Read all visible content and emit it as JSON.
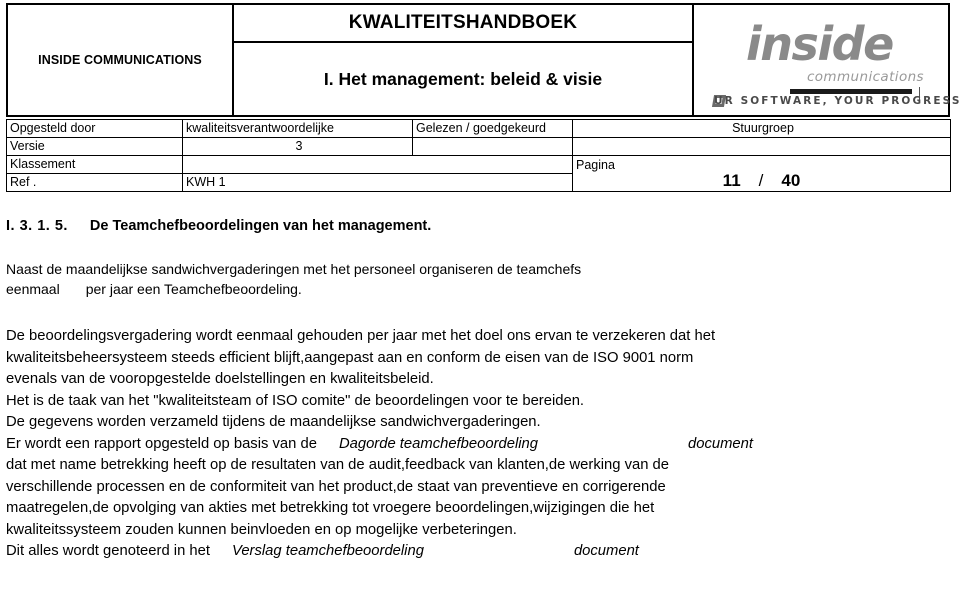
{
  "header": {
    "company_name": "INSIDE COMMUNICATIONS",
    "title_main": "KWALITEITSHANDBOEK",
    "title_sub": "I. Het management: beleid & visie",
    "logo": {
      "wordmark": "inside",
      "sub_wordmark": "communications",
      "tagline": "UR SOFTWARE, YOUR PROGRESS",
      "tagline_full": "OUR SOFTWARE, YOUR PROGRESS"
    }
  },
  "meta_table": {
    "rows": [
      {
        "label": "Opgesteld door",
        "value": "kwaliteitsverantwoordelijke",
        "approval_label": "Gelezen / goedgekeurd",
        "approval_value": "Stuurgroep"
      },
      {
        "label": "Versie",
        "value": "3",
        "approval_label": "",
        "approval_value": ""
      },
      {
        "label": "Klassement",
        "value": "",
        "page_label": "Pagina"
      },
      {
        "label": "Ref .",
        "value": "KWH 1",
        "page_current": "11",
        "page_separator": "/",
        "page_total": "40"
      }
    ]
  },
  "content": {
    "section_number": "I.  3.  1.  5.",
    "section_title": "De Teamchefbeoordelingen van het management.",
    "intro_line_1": "Naast de maandelijkse sandwichvergaderingen met het personeel organiseren de teamchefs",
    "intro_line_2a": "eenmaal",
    "intro_line_2b": "per jaar een Teamchefbeoordeling.",
    "body_lines": [
      "De beoordelingsvergadering wordt eenmaal gehouden per jaar met het doel ons ervan te verzekeren dat het",
      "kwaliteitsbeheersysteem steeds efficient blijft,aangepast aan en conform de eisen van de ISO 9001 norm",
      "evenals van de vooropgestelde doelstellingen en kwaliteitsbeleid.",
      "Het is de taak van het \"kwaliteitsteam of ISO comite\" de beoordelingen voor te bereiden.",
      "De gegevens worden verzameld tijdens de maandelijkse sandwichvergaderingen."
    ],
    "report_line": {
      "pre": "Er wordt een rapport opgesteld op basis van de",
      "italic": "Dagorde teamchefbeoordeling",
      "post": "document"
    },
    "body_lines_2": [
      "dat met name betrekking heeft op de resultaten van de audit,feedback van klanten,de werking van de",
      "verschillende processen en de conformiteit van het product,de staat van preventieve en corrigerende",
      "maatregelen,de opvolging van akties met betrekking tot vroegere beoordelingen,wijzigingen die het",
      "kwaliteitssysteem zouden kunnen beinvloeden en op mogelijke verbeteringen."
    ],
    "final_line": {
      "pre": "Dit alles wordt genoteerd in het",
      "italic": "Verslag teamchefbeoordeling",
      "post": "document"
    }
  }
}
